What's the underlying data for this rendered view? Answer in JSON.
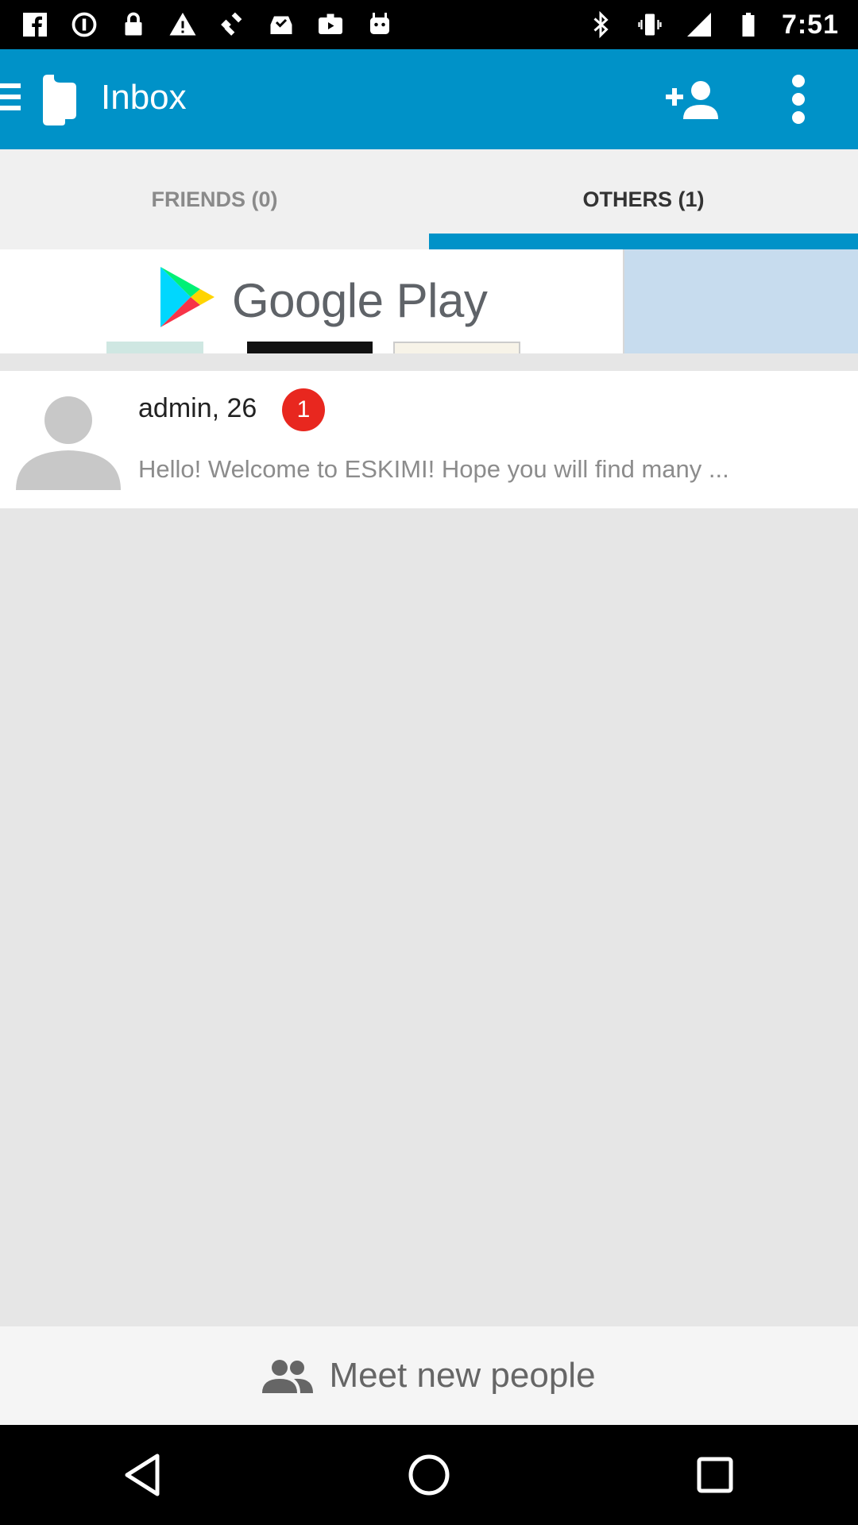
{
  "status_bar": {
    "time": "7:51",
    "left_icons": [
      "facebook-icon",
      "data-saver-icon",
      "lock-icon",
      "warning-icon",
      "fake-gps-icon",
      "inbox-check-icon",
      "video-icon",
      "android-icon"
    ],
    "right_icons": [
      "bluetooth-icon",
      "vibrate-icon",
      "signal-icon",
      "battery-icon"
    ]
  },
  "app_bar": {
    "title": "Inbox",
    "color": "#0092c8"
  },
  "tabs": [
    {
      "label": "FRIENDS (0)",
      "selected": false
    },
    {
      "label": "OTHERS (1)",
      "selected": true
    }
  ],
  "ad": {
    "text": "Google Play"
  },
  "messages": [
    {
      "sender": "admin, 26",
      "unread": "1",
      "preview": "Hello! Welcome to ESKIMI! Hope you will find many ..."
    }
  ],
  "bottom": {
    "label": "Meet new people"
  },
  "colors": {
    "accent": "#0092c8",
    "badge": "#e8271f"
  }
}
